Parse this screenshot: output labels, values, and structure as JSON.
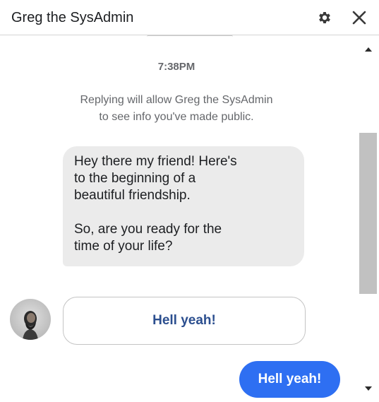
{
  "header": {
    "title": "Greg the SysAdmin",
    "settings_icon": "gear-icon",
    "close_icon": "close-icon"
  },
  "conversation": {
    "timestamp": "7:38PM",
    "notice": "Replying will allow Greg the SysAdmin\nto see info you've made public.",
    "incoming_message": {
      "paragraph_1": "Hey there my friend! Here's\nto the beginning of a\nbeautiful friendship.",
      "paragraph_2": "So, are you ready for the\ntime of your life?"
    },
    "quick_reply": "Hell yeah!",
    "outgoing_message": "Hell yeah!"
  },
  "colors": {
    "outgoing_bubble": "#2e6ff2",
    "incoming_bubble": "#ebebeb",
    "quick_reply_text": "#2c4f8f"
  }
}
